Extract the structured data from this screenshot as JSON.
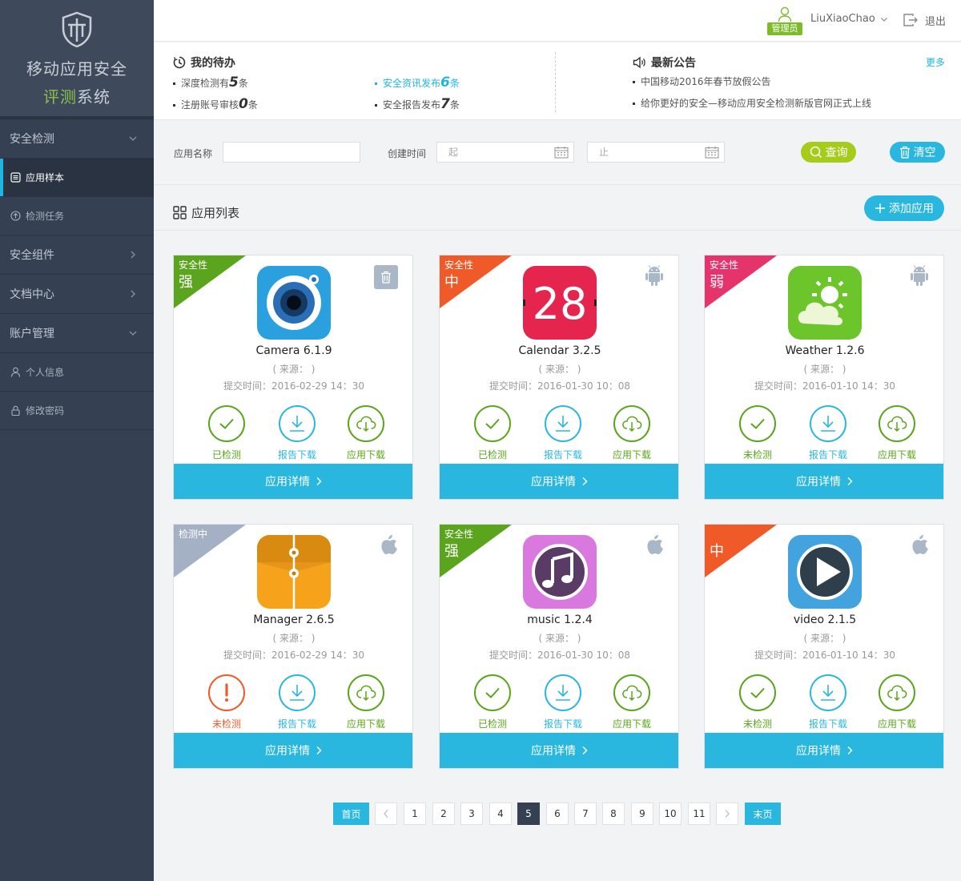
{
  "sidebar": {
    "title_line1": "移动应用安全",
    "title_line2a": "评测",
    "title_line2b": "系统",
    "items": [
      {
        "label": "安全检测"
      },
      {
        "label": "应用样本"
      },
      {
        "label": "检测任务"
      },
      {
        "label": "安全组件"
      },
      {
        "label": "文档中心"
      },
      {
        "label": "账户管理"
      },
      {
        "label": "个人信息"
      },
      {
        "label": "修改密码"
      }
    ]
  },
  "header": {
    "role_badge": "管理员",
    "username": "LiuXiaoChao",
    "logout": "退出"
  },
  "todo": {
    "title": "我的待办",
    "items": [
      {
        "pre": "深度检测有",
        "num": "5",
        "post": "条"
      },
      {
        "pre": "注册账号审核",
        "num": "0",
        "post": "条"
      },
      {
        "pre": "安全资讯发布",
        "num": "6",
        "post": "条"
      },
      {
        "pre": "安全报告发布",
        "num": "7",
        "post": "条"
      }
    ]
  },
  "announce": {
    "title": "最新公告",
    "more": "更多",
    "items": [
      "中国移动2016年春节放假公告",
      "给你更好的安全—移动应用安全检测新版官网正式上线"
    ]
  },
  "filter": {
    "name_label": "应用名称",
    "time_label": "创建时间",
    "start_placeholder": "起",
    "end_placeholder": "止",
    "query": "查询",
    "clear": "清空"
  },
  "list": {
    "title": "应用列表",
    "add": "添加应用"
  },
  "cards": [
    {
      "name": "Camera 6.1.9",
      "source": "( 来源： )",
      "time": "提交时间：2016-02-29  14：30",
      "r1": "安全性",
      "r2": "强",
      "ribbon_color": "#5aa51d",
      "platform": "trash",
      "status": "已检测",
      "status_color": "#5aa51d",
      "status_icon": "check",
      "report": "报告下载",
      "download": "应用下载",
      "detail": "应用详情"
    },
    {
      "name": "Calendar 3.2.5",
      "source": "( 来源： )",
      "time": "提交时间：2016-01-30  10：08",
      "r1": "安全性",
      "r2": "中",
      "ribbon_color": "#f05a28",
      "platform": "android",
      "status": "已检测",
      "status_color": "#5aa51d",
      "status_icon": "check",
      "report": "报告下载",
      "download": "应用下载",
      "detail": "应用详情",
      "calendar_day": "28"
    },
    {
      "name": "Weather 1.2.6",
      "source": "( 来源： )",
      "time": "提交时间：2016-01-10  14：30",
      "r1": "安全性",
      "r2": "弱",
      "ribbon_color": "#e5336b",
      "platform": "android",
      "status": "未检测",
      "status_color": "#5aa51d",
      "status_icon": "check",
      "report": "报告下载",
      "download": "应用下载",
      "detail": "应用详情"
    },
    {
      "name": "Manager 2.6.5",
      "source": "( 来源： )",
      "time": "提交时间：2016-02-29  14：30",
      "r1": "检测中",
      "r2": "",
      "ribbon_color": "#a4b1c4",
      "platform": "apple",
      "status": "未检测",
      "status_color": "#f05a28",
      "status_icon": "alert",
      "report": "报告下载",
      "download": "应用下载",
      "detail": "应用详情"
    },
    {
      "name": "music 1.2.4",
      "source": "( 来源： )",
      "time": "提交时间：2016-01-30  10：08",
      "r1": "安全性",
      "r2": "强",
      "ribbon_color": "#5aa51d",
      "platform": "apple",
      "status": "已检测",
      "status_color": "#5aa51d",
      "status_icon": "check",
      "report": "报告下载",
      "download": "应用下载",
      "detail": "应用详情"
    },
    {
      "name": "video 2.1.5",
      "source": "( 来源： )",
      "time": "提交时间：2016-01-10  14：30",
      "r1": "",
      "r2": "中",
      "ribbon_color": "#f05a28",
      "platform": "apple",
      "status": "未检测",
      "status_color": "#5aa51d",
      "status_icon": "check",
      "report": "报告下载",
      "download": "应用下载",
      "detail": "应用详情"
    }
  ],
  "pagination": {
    "first": "首页",
    "last": "末页",
    "pages": [
      "1",
      "2",
      "3",
      "4",
      "5",
      "6",
      "7",
      "8",
      "9",
      "10",
      "11"
    ],
    "current": 5
  },
  "colors": {
    "accent": "#29b7e0",
    "green": "#5aa51d",
    "sidebar": "#354052"
  }
}
